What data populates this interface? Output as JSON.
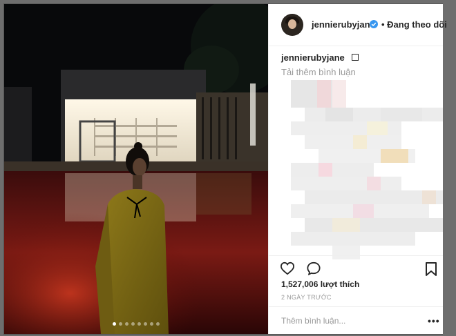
{
  "post": {
    "username": "jennierubyjane",
    "follow_status": "• Đang theo dõi",
    "caption_user": "jennierubyjane",
    "load_more": "Tải thêm bình luận",
    "likes": "1,527,006 lượt thích",
    "time_ago": "2 NGÀY TRƯỚC",
    "comment_placeholder": "Thêm bình luận...",
    "more_options": "•••"
  },
  "carousel": {
    "count": 8,
    "active_index": 0
  },
  "icons": {
    "verified": "verified-badge-icon",
    "like": "heart-icon",
    "comment": "comment-bubble-icon",
    "save": "bookmark-icon",
    "caption": "square-emoji-icon"
  },
  "colors": {
    "verified": "#3897f0",
    "text": "#262626",
    "muted": "#999999"
  }
}
